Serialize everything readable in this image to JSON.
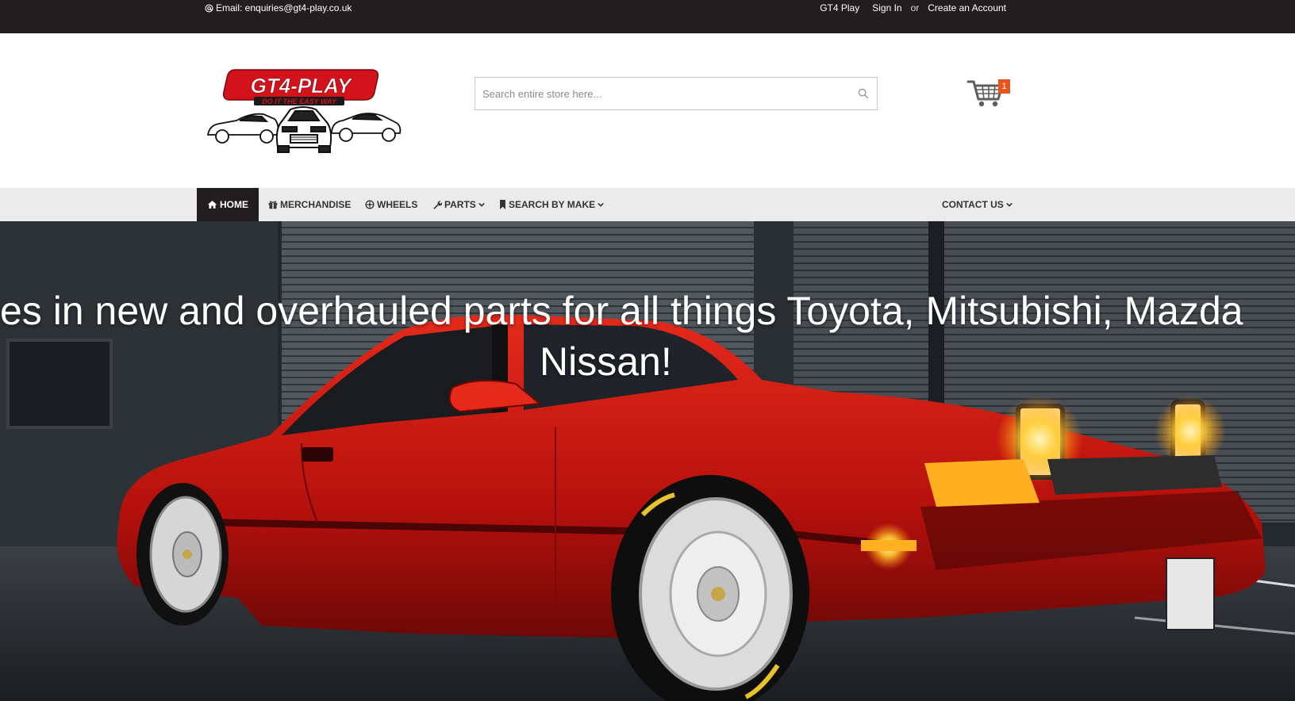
{
  "topbar": {
    "email_label": "Email: enquiries@gt4-play.co.uk",
    "store_link": "GT4 Play",
    "sign_in": "Sign In",
    "or": "or",
    "create_account": "Create an Account"
  },
  "header": {
    "logo_text": "GT4-PLAY",
    "logo_tagline": "DO IT THE EASY WAY",
    "search_placeholder": "Search entire store here...",
    "cart_count": "1"
  },
  "nav": {
    "items": [
      {
        "label": "HOME",
        "icon": "home-icon"
      },
      {
        "label": "MERCHANDISE",
        "icon": "gift-icon"
      },
      {
        "label": "WHEELS",
        "icon": "wheel-icon"
      },
      {
        "label": "PARTS",
        "icon": "wrench-icon"
      },
      {
        "label": "SEARCH BY MAKE",
        "icon": "bookmark-icon"
      },
      {
        "label": "CONTACT US",
        "icon": "chevron-down-icon"
      }
    ]
  },
  "hero": {
    "line1": "es in new and overhauled parts for all things Toyota, Mitsubishi, Mazda",
    "line2": "Nissan!"
  },
  "colors": {
    "topbar_bg": "#221e1f",
    "accent_red": "#d4121c",
    "cart_badge": "#e8541e",
    "nav_bg": "#ebebeb"
  }
}
